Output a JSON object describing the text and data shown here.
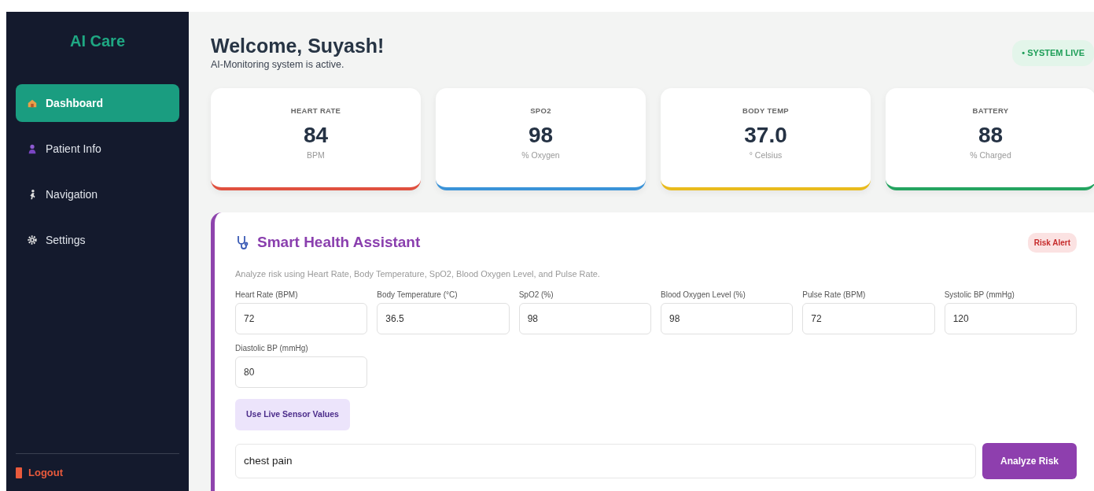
{
  "sidebar": {
    "brand": "AI Care",
    "items": [
      {
        "label": "Dashboard",
        "selected": true
      },
      {
        "label": "Patient Info",
        "selected": false
      },
      {
        "label": "Navigation",
        "selected": false
      },
      {
        "label": "Settings",
        "selected": false
      }
    ],
    "logout": {
      "label": "Logout"
    }
  },
  "header": {
    "title": "Welcome, Suyash!",
    "subtitle": "AI-Monitoring system is active.",
    "status": "• SYSTEM LIVE"
  },
  "stats": [
    {
      "label": "HEART RATE",
      "value": "84",
      "unit": "BPM",
      "color": "#e0503f"
    },
    {
      "label": "SPO2",
      "value": "98",
      "unit": "% Oxygen",
      "color": "#3a93d8"
    },
    {
      "label": "BODY TEMP",
      "value": "37.0",
      "unit": "° Celsius",
      "color": "#e9bb1c"
    },
    {
      "label": "BATTERY",
      "value": "88",
      "unit": "% Charged",
      "color": "#24a460"
    }
  ],
  "assistant": {
    "title": "Smart Health Assistant",
    "badge": "Risk Alert",
    "description": "Analyze risk using Heart Rate, Body Temperature, SpO2, Blood Oxygen Level, and Pulse Rate.",
    "fields": [
      {
        "label": "Heart Rate (BPM)",
        "value": "72"
      },
      {
        "label": "Body Temperature (°C)",
        "value": "36.5"
      },
      {
        "label": "SpO2 (%)",
        "value": "98"
      },
      {
        "label": "Blood Oxygen Level (%)",
        "value": "98"
      },
      {
        "label": "Pulse Rate (BPM)",
        "value": "72"
      },
      {
        "label": "Systolic BP (mmHg)",
        "value": "120"
      },
      {
        "label": "Diastolic BP (mmHg)",
        "value": "80"
      }
    ],
    "live_button": "Use Live Sensor Values",
    "symptoms": {
      "value": "chest pain"
    },
    "analyze_button": "Analyze Risk"
  }
}
